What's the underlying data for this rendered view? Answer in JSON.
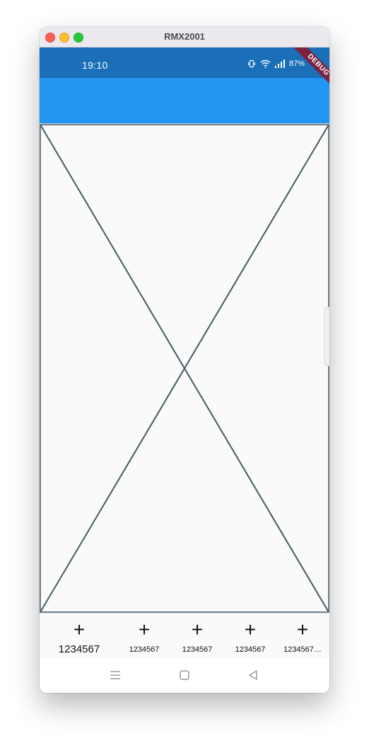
{
  "window": {
    "title": "RMX2001"
  },
  "status_bar": {
    "time": "19:10",
    "battery": "87%",
    "icons": [
      "vibrate-icon",
      "wifi-icon",
      "signal-icon",
      "battery-icon"
    ]
  },
  "debug_banner": {
    "label": "DEBUG"
  },
  "colors": {
    "status_bar": "#1a6fb8",
    "app_bar": "#2196f3",
    "debug_banner": "#7a2341",
    "placeholder_stroke": "#455a64",
    "background": "#fafafa"
  },
  "bottom_nav": {
    "items": [
      {
        "icon": "+",
        "label": "1234567",
        "selected": true
      },
      {
        "icon": "+",
        "label": "1234567",
        "selected": false
      },
      {
        "icon": "+",
        "label": "1234567",
        "selected": false
      },
      {
        "icon": "+",
        "label": "1234567",
        "selected": false
      },
      {
        "icon": "+",
        "label": "1234567…",
        "selected": false
      }
    ]
  },
  "system_nav": {
    "buttons": [
      "menu-icon",
      "home-icon",
      "back-icon"
    ]
  }
}
